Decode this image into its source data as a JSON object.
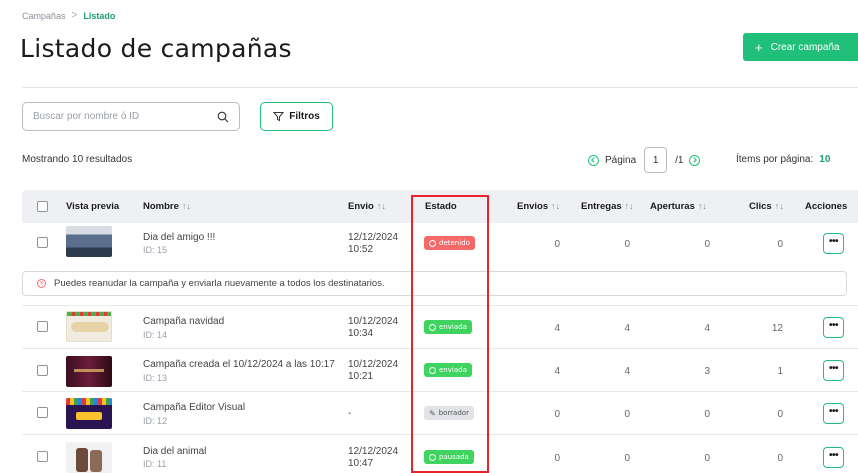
{
  "breadcrumb": {
    "parent": "Campañas",
    "separator": ">",
    "current": "Listado"
  },
  "page_title": "Listado de campañas",
  "create_button": {
    "icon": "+",
    "label": "Crear campaña"
  },
  "search": {
    "placeholder": "Buscar por nombre ó ID",
    "icon": "search-icon"
  },
  "filters": {
    "label": "Filtros",
    "icon": "filter-icon"
  },
  "results_text": "Mostrando 10 resultados",
  "pagination": {
    "label": "Página",
    "current": "1",
    "total": "/1"
  },
  "per_page": {
    "label": "Ítems por página:",
    "value": "10"
  },
  "columns": {
    "preview": "Vista previa",
    "name": "Nombre",
    "sent_date": "Envio",
    "status": "Estado",
    "sends": "Envios",
    "deliveries": "Entregas",
    "opens": "Aperturas",
    "clicks": "Clics",
    "actions": "Acciones",
    "sort_icon": "↑↓"
  },
  "rows": [
    {
      "name": "Dia del amigo !!!",
      "id": "ID: 15",
      "date": "12/12/2024",
      "time": "10:52",
      "status": "detenido",
      "sends": "0",
      "deliveries": "0",
      "opens": "0",
      "clicks": "0",
      "actions": "•••"
    },
    {
      "name": "Campaña navidad",
      "id": "ID: 14",
      "date": "10/12/2024",
      "time": "10:34",
      "status": "enviada",
      "sends": "4",
      "deliveries": "4",
      "opens": "4",
      "clicks": "12",
      "actions": "•••"
    },
    {
      "name": "Campaña creada el 10/12/2024 a las 10:17",
      "id": "ID: 13",
      "date": "10/12/2024",
      "time": "10:21",
      "status": "enviada",
      "sends": "4",
      "deliveries": "4",
      "opens": "3",
      "clicks": "1",
      "actions": "•••"
    },
    {
      "name": "Campaña Editor Visual",
      "id": "ID: 12",
      "date": "-",
      "time": "",
      "status": "borrador",
      "sends": "0",
      "deliveries": "0",
      "opens": "0",
      "clicks": "0",
      "actions": "•••"
    },
    {
      "name": "Dia del animal",
      "id": "ID: 11",
      "date": "12/12/2024",
      "time": "10:47",
      "status": "pausada",
      "sends": "0",
      "deliveries": "0",
      "opens": "0",
      "clicks": "0",
      "actions": "•••"
    }
  ],
  "notice": "Puedes reanudar la campaña y enviarla nuevamente a todos los destinatarios.",
  "colors": {
    "accent": "#20c07b",
    "error": "#f46a6a",
    "success": "#3fd45f",
    "highlight": "#e8242a"
  }
}
